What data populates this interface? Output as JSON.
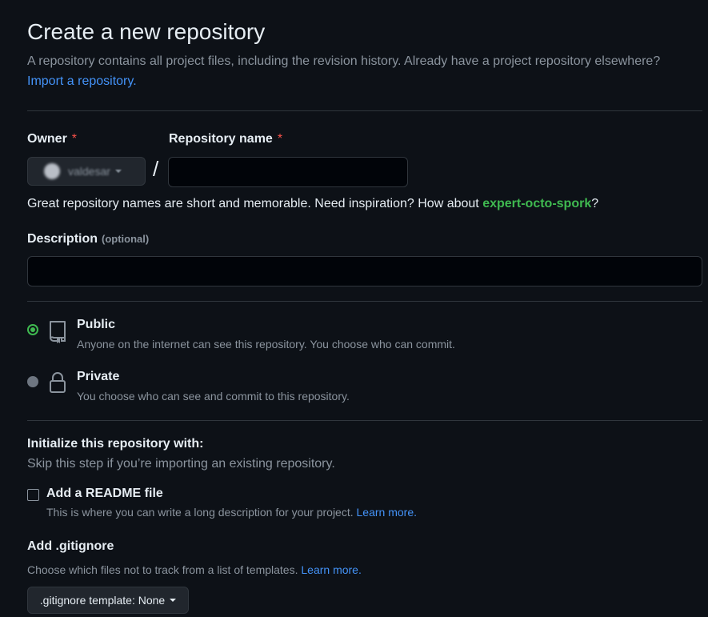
{
  "header": {
    "title": "Create a new repository",
    "subtitle": "A repository contains all project files, including the revision history. Already have a project repository elsewhere?",
    "import_link": "Import a repository."
  },
  "owner": {
    "label": "Owner",
    "required_mark": "*",
    "value": "valdesar"
  },
  "repo_name": {
    "label": "Repository name",
    "required_mark": "*",
    "value": ""
  },
  "separator": "/",
  "name_hint": {
    "text": "Great repository names are short and memorable. Need inspiration? How about",
    "suggestion": "expert-octo-spork",
    "end": "?"
  },
  "description": {
    "label": "Description",
    "optional": "(optional)",
    "value": ""
  },
  "visibility": {
    "selected": "Public",
    "options": [
      {
        "title": "Public",
        "desc": "Anyone on the internet can see this repository. You choose who can commit."
      },
      {
        "title": "Private",
        "desc": "You choose who can see and commit to this repository."
      }
    ]
  },
  "init": {
    "title": "Initialize this repository with:",
    "subtitle": "Skip this step if you’re importing an existing repository.",
    "readme": {
      "label": "Add a README file",
      "desc": "This is where you can write a long description for your project.",
      "link": "Learn more.",
      "checked": false
    }
  },
  "gitignore": {
    "title": "Add .gitignore",
    "desc": "Choose which files not to track from a list of templates.",
    "link": "Learn more.",
    "button": ".gitignore template: None"
  },
  "colors": {
    "background": "#0d1117",
    "accent_link": "#4493f8",
    "success": "#3fb950",
    "required": "#f85149"
  }
}
